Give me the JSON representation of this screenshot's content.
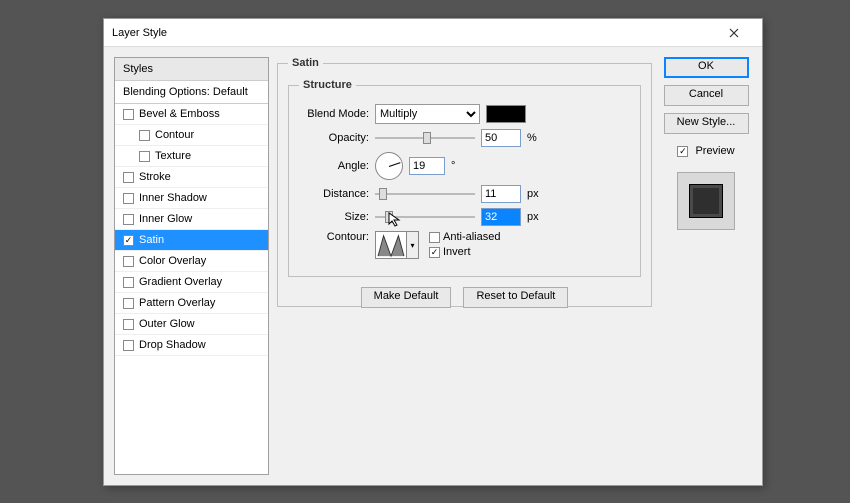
{
  "window": {
    "title": "Layer Style"
  },
  "styles": {
    "header": "Styles",
    "blending": "Blending Options: Default",
    "items": [
      {
        "label": "Bevel & Emboss",
        "checked": false,
        "indent": false
      },
      {
        "label": "Contour",
        "checked": false,
        "indent": true
      },
      {
        "label": "Texture",
        "checked": false,
        "indent": true
      },
      {
        "label": "Stroke",
        "checked": false,
        "indent": false
      },
      {
        "label": "Inner Shadow",
        "checked": false,
        "indent": false
      },
      {
        "label": "Inner Glow",
        "checked": false,
        "indent": false
      },
      {
        "label": "Satin",
        "checked": true,
        "indent": false,
        "selected": true
      },
      {
        "label": "Color Overlay",
        "checked": false,
        "indent": false
      },
      {
        "label": "Gradient Overlay",
        "checked": false,
        "indent": false
      },
      {
        "label": "Pattern Overlay",
        "checked": false,
        "indent": false
      },
      {
        "label": "Outer Glow",
        "checked": false,
        "indent": false
      },
      {
        "label": "Drop Shadow",
        "checked": false,
        "indent": false
      }
    ]
  },
  "panel": {
    "title": "Satin",
    "group": "Structure",
    "blend_label": "Blend Mode:",
    "blend_value": "Multiply",
    "color_swatch": "#000000",
    "opacity_label": "Opacity:",
    "opacity_value": "50",
    "opacity_unit": "%",
    "angle_label": "Angle:",
    "angle_value": "19",
    "angle_unit": "°",
    "distance_label": "Distance:",
    "distance_value": "11",
    "distance_unit": "px",
    "size_label": "Size:",
    "size_value": "32",
    "size_unit": "px",
    "contour_label": "Contour:",
    "antialias_label": "Anti-aliased",
    "antialias_checked": false,
    "invert_label": "Invert",
    "invert_checked": true,
    "make_default": "Make Default",
    "reset_default": "Reset to Default"
  },
  "right": {
    "ok": "OK",
    "cancel": "Cancel",
    "new_style": "New Style...",
    "preview_label": "Preview",
    "preview_checked": true
  }
}
